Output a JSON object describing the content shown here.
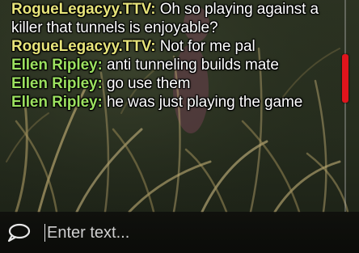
{
  "chat": {
    "messages": [
      {
        "sender": "RogueLegacyy.TTV",
        "role": "killer",
        "text": "Oh so playing against a killer that tunnels is enjoyable?"
      },
      {
        "sender": "RogueLegacyy.TTV",
        "role": "killer",
        "text": "Not for me pal"
      },
      {
        "sender": "Ellen Ripley",
        "role": "survivor",
        "text": "anti tunneling builds mate"
      },
      {
        "sender": "Ellen Ripley",
        "role": "survivor",
        "text": "go use them"
      },
      {
        "sender": "Ellen Ripley",
        "role": "survivor",
        "text": "he was just playing the game"
      }
    ],
    "scroll_position": 0.33
  },
  "input": {
    "placeholder": "Enter text...",
    "value": ""
  },
  "colors": {
    "killer_name": "#e7e47a",
    "survivor_name": "#9be05f",
    "message_text": "#ffffff",
    "scroll_thumb": "#e0141c"
  },
  "icons": {
    "chat": "speech-bubble-icon"
  }
}
